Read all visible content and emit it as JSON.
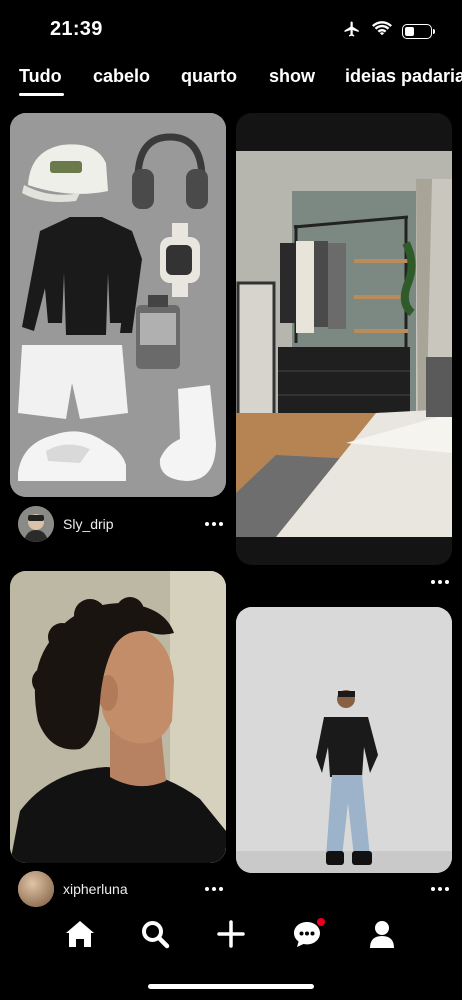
{
  "status_bar": {
    "time": "21:39",
    "battery_level": 0.4
  },
  "tabs": [
    {
      "label": "Tudo",
      "selected": true
    },
    {
      "label": "cabelo",
      "selected": false
    },
    {
      "label": "quarto",
      "selected": false
    },
    {
      "label": "show",
      "selected": false
    },
    {
      "label": "ideias padaria",
      "selected": false
    }
  ],
  "pins": [
    {
      "id": "outfit",
      "user": "Sly_drip"
    },
    {
      "id": "bedroom",
      "user": ""
    },
    {
      "id": "portrait",
      "user": "xipherluna"
    },
    {
      "id": "street-style",
      "user": ""
    }
  ],
  "nav": {
    "items": [
      "home-icon",
      "search-icon",
      "create-icon",
      "messages-icon",
      "profile-icon"
    ],
    "accent": "#e60023"
  }
}
